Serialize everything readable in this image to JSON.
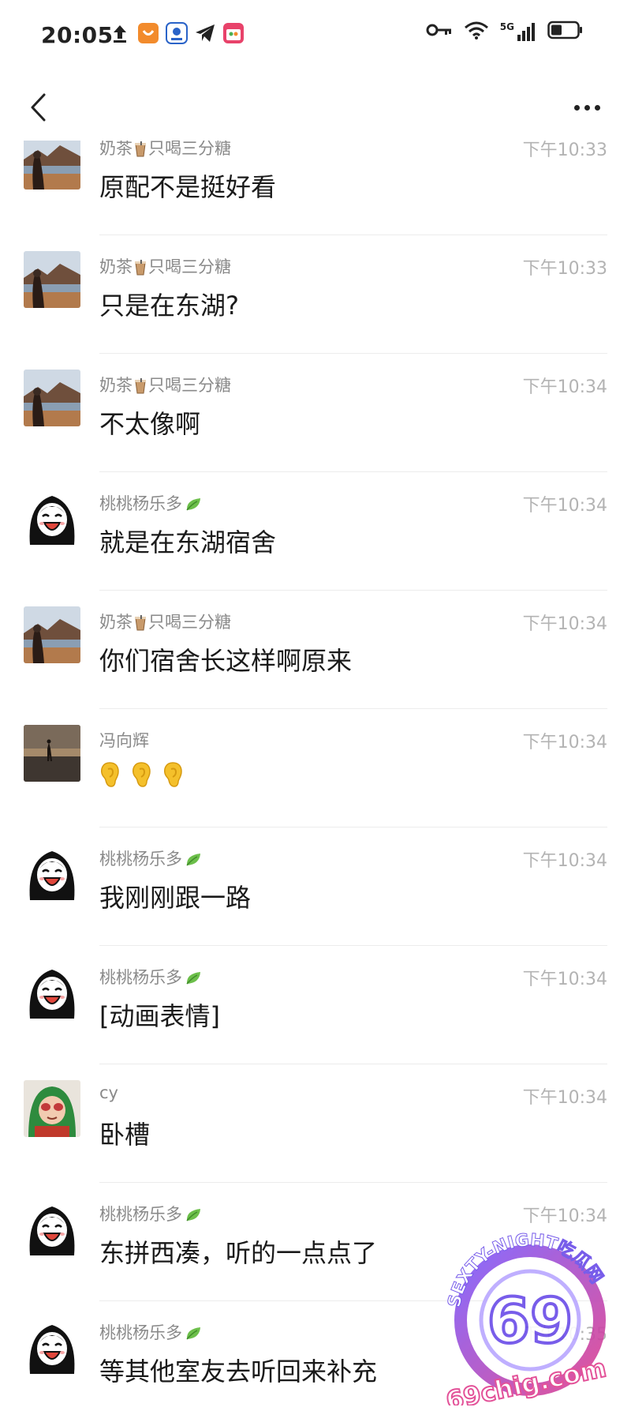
{
  "status_bar": {
    "time": "20:05",
    "network_label": "5G",
    "icons_left": [
      "upload-icon",
      "app-badge-icon",
      "location-app-icon",
      "telegram-icon",
      "app-tile-icon"
    ],
    "icons_right": [
      "vpn-key-icon",
      "wifi-icon",
      "cellular-signal-icon",
      "battery-icon"
    ]
  },
  "nav": {
    "back_icon": "chevron-left-icon",
    "more_icon": "more-dots-icon"
  },
  "messages": [
    {
      "sender": "奶茶",
      "sender_suffix": "只喝三分糖",
      "time": "下午10:33",
      "text": "原配不是挺好看",
      "avatar": "landscape"
    },
    {
      "sender": "奶茶",
      "sender_suffix": "只喝三分糖",
      "time": "下午10:33",
      "text": "只是在东湖?",
      "avatar": "landscape"
    },
    {
      "sender": "奶茶",
      "sender_suffix": "只喝三分糖",
      "time": "下午10:34",
      "text": "不太像啊",
      "avatar": "landscape"
    },
    {
      "sender": "桃桃杨乐多",
      "time": "下午10:34",
      "text": "就是在东湖宿舍",
      "avatar": "cartoon-girl"
    },
    {
      "sender": "奶茶",
      "sender_suffix": "只喝三分糖",
      "time": "下午10:34",
      "text": "你们宿舍长这样啊原来",
      "avatar": "landscape"
    },
    {
      "sender": "冯向辉",
      "time": "下午10:34",
      "text": "",
      "avatar": "sunset",
      "emoji": [
        "ear",
        "ear",
        "ear"
      ]
    },
    {
      "sender": "桃桃杨乐多",
      "time": "下午10:34",
      "text": "我刚刚跟一路",
      "avatar": "cartoon-girl"
    },
    {
      "sender": "桃桃杨乐多",
      "time": "下午10:34",
      "text": "[动画表情]",
      "avatar": "cartoon-girl"
    },
    {
      "sender": "cy",
      "time": "下午10:34",
      "text": "卧槽",
      "avatar": "kid-green"
    },
    {
      "sender": "桃桃杨乐多",
      "time": "下午10:34",
      "text": "东拼西凑，听的一点点了",
      "avatar": "cartoon-girl"
    },
    {
      "sender": "桃桃杨乐多",
      "time": "下午10:35",
      "text": "等其他室友去听回来补充",
      "avatar": "cartoon-girl"
    }
  ],
  "watermark": {
    "ring_text": "SEXTY-NIGHT吃瓜网",
    "number": "69",
    "site": "69chig.com"
  }
}
